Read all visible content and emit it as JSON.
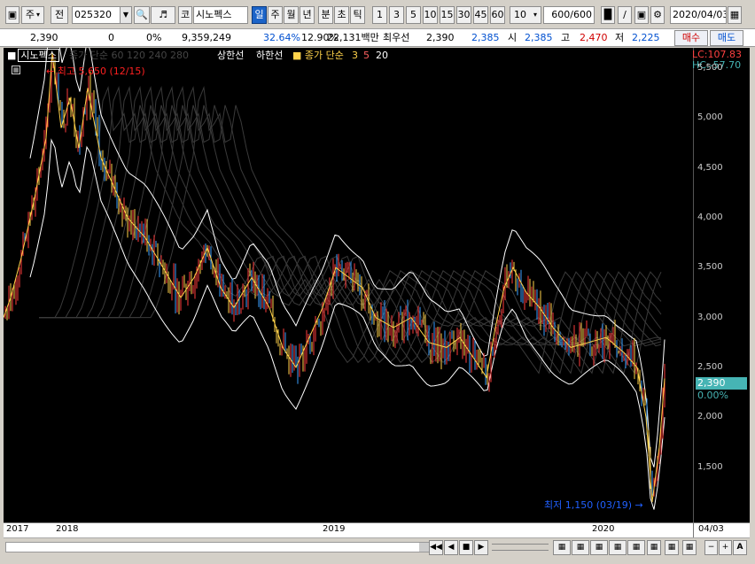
{
  "toolbar": {
    "period_sel": "주",
    "prev_label": "전",
    "code": "025320",
    "search_icon": "search-icon",
    "name_prefix": "코",
    "stock_name": "시노펙스",
    "timeframes": [
      "일",
      "주",
      "월",
      "년",
      "분",
      "초",
      "틱"
    ],
    "active_timeframe": "일",
    "intervals": [
      "1",
      "3",
      "5",
      "10",
      "15",
      "30",
      "45",
      "60"
    ],
    "interval_select": "10",
    "count_current": "600",
    "count_total": "/600",
    "date": "2020/04/03"
  },
  "info": {
    "price": "2,390",
    "change": "0",
    "change_pct": "0%",
    "volume": "9,359,249",
    "vol_ratio": "32.64%",
    "turnover": "12.90%",
    "amount": "22,131백만",
    "best_label": "최우선",
    "best_price": "2,390",
    "ask": "2,385",
    "open_label": "시",
    "open": "2,385",
    "high_label": "고",
    "high": "2,470",
    "low_label": "저",
    "low": "2,225",
    "buy_label": "매수",
    "sell_label": "매도"
  },
  "legend": {
    "name": "시노펙스",
    "ma_dim": "종가 단순 60  120  240  280",
    "upper": "상한선",
    "lower": "하한선",
    "ma_title": "종가 단순",
    "ma3": "3",
    "ma5": "5",
    "ma20": "20"
  },
  "chart_data": {
    "type": "candlestick",
    "high_marker": "최고 5,650 (12/15)",
    "low_marker": "최저 1,150 (03/19)",
    "lc": "LC:107.83",
    "hc": "HC:-57.70",
    "last_price": "2,390",
    "last_pct": "0.00%",
    "yticks": [
      "5,500",
      "5,000",
      "4,500",
      "4,000",
      "3,500",
      "3,000",
      "2,500",
      "2,000",
      "1,500"
    ],
    "xticks": [
      "2017",
      "2018",
      "2019",
      "2020",
      "04/03"
    ],
    "ylim": [
      1000,
      5650
    ],
    "close_path": [
      [
        0,
        3000
      ],
      [
        8,
        3200
      ],
      [
        20,
        3600
      ],
      [
        35,
        4200
      ],
      [
        48,
        4800
      ],
      [
        55,
        5650
      ],
      [
        65,
        4900
      ],
      [
        75,
        5200
      ],
      [
        85,
        4700
      ],
      [
        95,
        5300
      ],
      [
        110,
        4600
      ],
      [
        125,
        4300
      ],
      [
        140,
        4000
      ],
      [
        160,
        3800
      ],
      [
        180,
        3500
      ],
      [
        200,
        3200
      ],
      [
        215,
        3400
      ],
      [
        230,
        3700
      ],
      [
        245,
        3300
      ],
      [
        260,
        3100
      ],
      [
        280,
        3400
      ],
      [
        300,
        3100
      ],
      [
        315,
        2700
      ],
      [
        330,
        2500
      ],
      [
        345,
        2800
      ],
      [
        360,
        3100
      ],
      [
        375,
        3500
      ],
      [
        390,
        3400
      ],
      [
        405,
        3300
      ],
      [
        420,
        3000
      ],
      [
        440,
        2900
      ],
      [
        460,
        3000
      ],
      [
        480,
        2750
      ],
      [
        500,
        2700
      ],
      [
        515,
        2800
      ],
      [
        530,
        2600
      ],
      [
        545,
        2400
      ],
      [
        555,
        2900
      ],
      [
        565,
        3300
      ],
      [
        575,
        3500
      ],
      [
        590,
        3250
      ],
      [
        605,
        3100
      ],
      [
        620,
        2900
      ],
      [
        640,
        2700
      ],
      [
        660,
        2750
      ],
      [
        680,
        2800
      ],
      [
        700,
        2650
      ],
      [
        715,
        2500
      ],
      [
        725,
        2000
      ],
      [
        732,
        1150
      ],
      [
        740,
        1700
      ],
      [
        746,
        2390
      ]
    ]
  },
  "bottom": {
    "icons": [
      "scroll-start-icon",
      "scroll-prev-icon",
      "stop-icon",
      "scroll-next-icon",
      "scroll-end-icon"
    ],
    "right_buttons": [
      "zoom-out-icon",
      "zoom-in-icon",
      "text-icon"
    ]
  },
  "colors": {
    "bg": "#000000",
    "up": "#ff3b3b",
    "down": "#3aa0ff",
    "envelope": "#ffffff",
    "accent": "#46b4b4",
    "high_marker": "#ff2020",
    "low_marker": "#2060ff"
  }
}
